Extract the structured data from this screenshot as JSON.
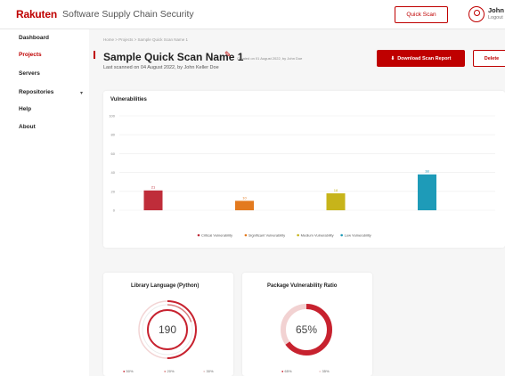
{
  "topbar": {
    "logo": "Rakuten",
    "app_title": "Software Supply Chain Security",
    "quick_scan_label": "Quick Scan",
    "user_name": "John D",
    "user_sub": "Logout"
  },
  "sidebar": {
    "items": [
      {
        "label": "Dashboard"
      },
      {
        "label": "Projects"
      },
      {
        "label": "Servers"
      },
      {
        "label": "Repositories"
      },
      {
        "label": "Help"
      },
      {
        "label": "About"
      }
    ]
  },
  "breadcrumb": "Home > Projects > Sample Quick Scan Name 1",
  "page": {
    "title": "Sample Quick Scan Name 1",
    "created": "Created on 01 August 2022, by John Doe",
    "last_scanned": "Last scanned on 04 August 2022, by John Keller Doe",
    "download_label": "Download Scan Report",
    "delete_label": "Delete"
  },
  "vuln_chart": {
    "title": "Vulnerabilities"
  },
  "chart_data": {
    "type": "bar",
    "title": "Vulnerabilities",
    "categories": [
      "Critical Vulnerability",
      "Significant Vulnerability",
      "Medium Vulnerability",
      "Low Vulnerability"
    ],
    "values": [
      21,
      10,
      18,
      38
    ],
    "value_labels": [
      "21",
      "10",
      "18",
      "38"
    ],
    "colors": [
      "#bf2d3a",
      "#e37a1f",
      "#c7b41a",
      "#1e9bb8"
    ],
    "ylim": [
      0,
      100
    ],
    "yticks": [
      "100",
      "80",
      "60",
      "40",
      "20",
      "0"
    ],
    "grid": true,
    "legend": "bottom-center"
  },
  "library_card": {
    "title": "Library Language (Python)",
    "center_value": "190",
    "legend": [
      "50%",
      "20%",
      "30%"
    ],
    "ring_fractions": [
      0.5,
      0.2,
      0.3
    ]
  },
  "package_card": {
    "title": "Package Vulnerability Ratio",
    "center_value": "65%",
    "ratio": 0.65,
    "legend": [
      "65%",
      "35%"
    ]
  },
  "colors": {
    "brand": "#bf0000"
  }
}
